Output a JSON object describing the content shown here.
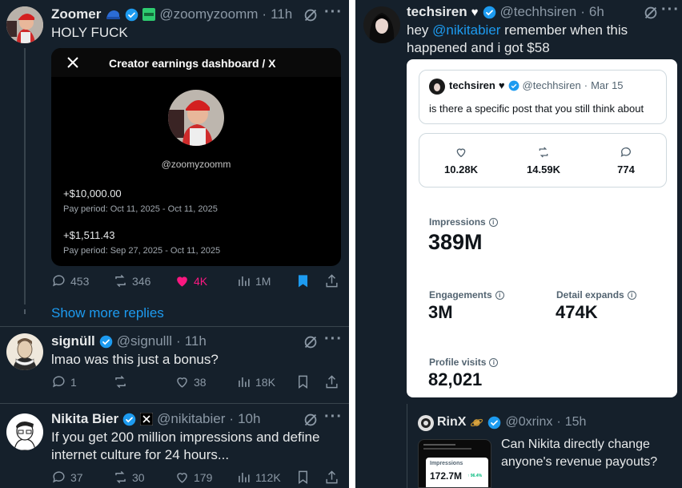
{
  "left": {
    "tweet1": {
      "name": "Zoomer",
      "handle": "@zoomyzoomm",
      "time": "11h",
      "text": "HOLY FUCK",
      "card": {
        "title": "Creator earnings dashboard / X",
        "username": "@zoomyzoomm",
        "amount1": "+$10,000.00",
        "period1": "Pay period: Oct 11, 2025 - Oct 11, 2025",
        "amount2": "+$1,511.43",
        "period2": "Pay period: Sep 27, 2025 - Oct 11, 2025"
      },
      "actions": {
        "replies": "453",
        "reposts": "346",
        "likes": "4K",
        "views": "1M"
      }
    },
    "show_more": "Show more replies",
    "tweet2": {
      "name": "signüll",
      "handle": "@signulll",
      "time": "11h",
      "text": "lmao was this just a bonus?",
      "actions": {
        "replies": "1",
        "reposts": "",
        "likes": "38",
        "views": "18K"
      }
    },
    "tweet3": {
      "name": "Nikita Bier",
      "handle": "@nikitabier",
      "time": "10h",
      "text": "If you get 200 million impressions and define internet culture for 24 hours...",
      "actions": {
        "replies": "37",
        "reposts": "30",
        "likes": "179",
        "views": "112K"
      }
    }
  },
  "right": {
    "tweet1": {
      "name": "techsiren",
      "heart": "♥",
      "handle": "@techhsiren",
      "time": "6h",
      "text_pre": "hey ",
      "mention": "@nikitabier",
      "text_post": " remember when this happened and i got $58"
    },
    "quoted": {
      "name": "techsiren",
      "heart": "♥",
      "handle": "@techhsiren",
      "date": "Mar 15",
      "text": "is there a specific post that you still think about"
    },
    "stats": {
      "likes": "10.28K",
      "reposts": "14.59K",
      "replies": "774"
    },
    "metrics": {
      "impressions_label": "Impressions",
      "impressions_value": "389M",
      "engagements_label": "Engagements",
      "engagements_value": "3M",
      "detail_label": "Detail expands",
      "detail_value": "474K",
      "profile_label": "Profile visits",
      "profile_value": "82,021"
    },
    "tweet2": {
      "name": "RinX",
      "handle": "@0xrinx",
      "time": "15h",
      "text": "Can Nikita directly change anyone's revenue payouts?",
      "thumb_label": "Impressions",
      "thumb_value": "172.7M",
      "thumb_change": "↑ 96.4%"
    }
  },
  "colors": {
    "bg": "#15202b",
    "link": "#1d9bf0",
    "like": "#f91880",
    "muted": "#8b98a5"
  }
}
